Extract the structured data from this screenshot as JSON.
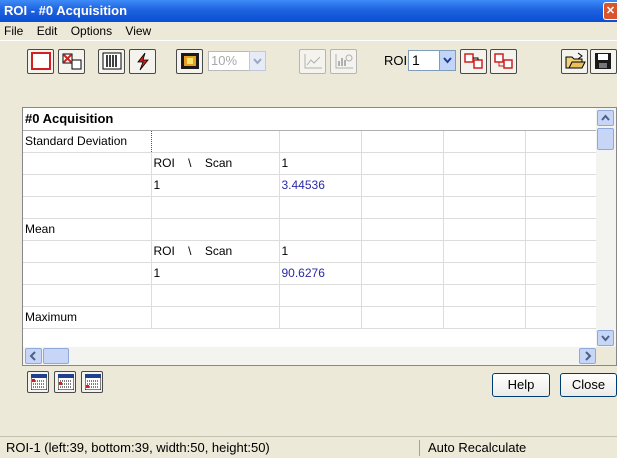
{
  "window": {
    "title": "ROI - #0  Acquisition"
  },
  "menu": [
    "File",
    "Edit",
    "Options",
    "View"
  ],
  "toolbar": {
    "percent_value": "10%",
    "roi_label": "ROI",
    "roi_value": "1"
  },
  "grid": {
    "header": "#0  Acquisition",
    "rows": [
      [
        "Standard Deviation",
        "",
        "",
        "",
        "",
        "",
        ""
      ],
      [
        "",
        "ROI    \\    Scan",
        "1",
        "",
        "",
        "",
        ""
      ],
      [
        "",
        "1",
        "3.44536",
        "",
        "",
        "",
        ""
      ],
      [
        "",
        "",
        "",
        "",
        "",
        "",
        ""
      ],
      [
        "Mean",
        "",
        "",
        "",
        "",
        "",
        ""
      ],
      [
        "",
        "ROI    \\    Scan",
        "1",
        "",
        "",
        "",
        ""
      ],
      [
        "",
        "1",
        "90.6276",
        "",
        "",
        "",
        ""
      ],
      [
        "",
        "",
        "",
        "",
        "",
        "",
        ""
      ],
      [
        "Maximum",
        "",
        "",
        "",
        "",
        "",
        ""
      ]
    ]
  },
  "buttons": {
    "help": "Help",
    "close": "Close"
  },
  "status": {
    "left": "ROI-1  (left:39, bottom:39, width:50, height:50)",
    "right": "Auto Recalculate"
  },
  "colors": {
    "title_blue": "#0a4fd3",
    "value_blue": "#2a2aa8",
    "accent_red": "#d02020"
  }
}
